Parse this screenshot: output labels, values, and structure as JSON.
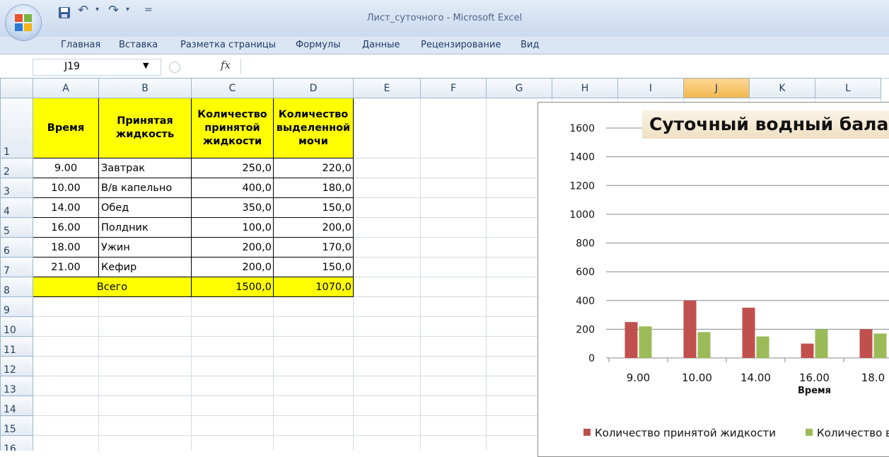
{
  "window": {
    "title": "Лист_суточного - Microsoft Excel"
  },
  "quick_access": {
    "save_icon": "floppy-disk-icon",
    "undo_icon": "undo-icon",
    "redo_icon": "redo-icon",
    "customize": "="
  },
  "ribbon": {
    "tabs": [
      "Главная",
      "Вставка",
      "Разметка страницы",
      "Формулы",
      "Данные",
      "Рецензирование",
      "Вид"
    ]
  },
  "formula_bar": {
    "name_box": "J19",
    "fx": "fx",
    "value": ""
  },
  "grid": {
    "columns": [
      "A",
      "B",
      "C",
      "D",
      "E",
      "F",
      "G",
      "H",
      "I",
      "J",
      "K",
      "L"
    ],
    "selected_column": "J",
    "rows": [
      "1",
      "2",
      "3",
      "4",
      "5",
      "6",
      "7",
      "8",
      "9",
      "10",
      "11",
      "12",
      "13",
      "14",
      "15",
      "16"
    ],
    "header_row": {
      "A": "Время",
      "B": "Принятая жидкость",
      "C": "Количество принятой жидкости",
      "D": "Количество выделенной мочи"
    },
    "data_rows": [
      [
        "9.00",
        "Завтрак",
        "250,0",
        "220,0"
      ],
      [
        "10.00",
        "В/в капельно",
        "400,0",
        "180,0"
      ],
      [
        "14.00",
        "Обед",
        "350,0",
        "150,0"
      ],
      [
        "16.00",
        "Полдник",
        "100,0",
        "200,0"
      ],
      [
        "18.00",
        "Ужин",
        "200,0",
        "170,0"
      ],
      [
        "21.00",
        "Кефир",
        "200,0",
        "150,0"
      ]
    ],
    "total_row": {
      "label": "Всего",
      "C": "1500,0",
      "D": "1070,0"
    },
    "colors": {
      "highlight": "#ffff00",
      "selected_header": "#f9c668"
    }
  },
  "chart_data": {
    "type": "bar",
    "title": "Суточный водный бала",
    "xlabel": "Время",
    "ylabel": "",
    "categories": [
      "9.00",
      "10.00",
      "14.00",
      "16.00",
      "18.0"
    ],
    "series": [
      {
        "name": "Количество принятой жидкости",
        "values": [
          250,
          400,
          350,
          100,
          200
        ],
        "color": "#c0504d"
      },
      {
        "name": "Количество в",
        "values": [
          220,
          180,
          150,
          200,
          170
        ],
        "color": "#9bbb59"
      }
    ],
    "ylim": [
      0,
      1600
    ],
    "yticks": [
      "0",
      "200",
      "400",
      "600",
      "800",
      "1000",
      "1200",
      "1400",
      "1600"
    ],
    "grid": true,
    "legend_position": "bottom"
  }
}
